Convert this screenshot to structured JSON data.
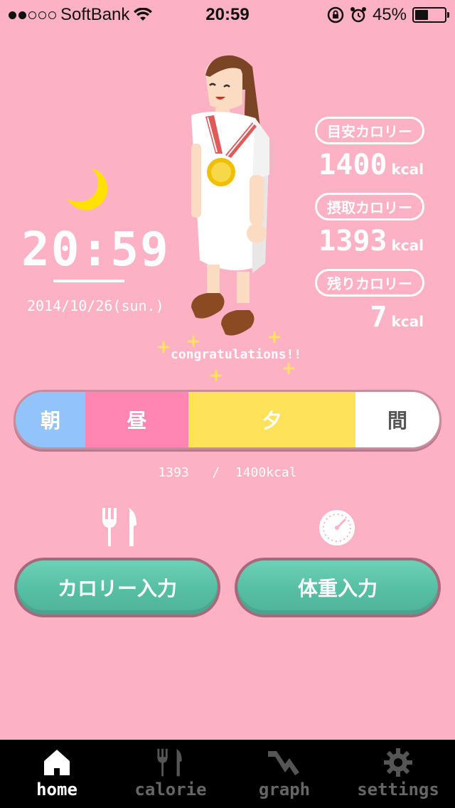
{
  "status_bar": {
    "carrier": "SoftBank",
    "time": "20:59",
    "battery_percent": "45%",
    "battery_level": 0.45,
    "signal_bars_filled": 2,
    "signal_bars_total": 5
  },
  "clock": {
    "time": "20:59",
    "date": "2014/10/26(sun.)"
  },
  "calories": {
    "target_label": "目安カロリー",
    "target_value": "1400",
    "intake_label": "摂取カロリー",
    "intake_value": "1393",
    "remaining_label": "残りカロリー",
    "remaining_value": "7",
    "unit": "kcal"
  },
  "congrats_text": "congratulations!!",
  "meal_bar": {
    "breakfast": "朝",
    "lunch": "昼",
    "dinner": "夕",
    "snack": "間"
  },
  "progress": {
    "current": "1393",
    "separator": "/",
    "total": "1400kcal"
  },
  "buttons": {
    "calorie_input": "カロリー入力",
    "weight_input": "体重入力"
  },
  "tabs": [
    {
      "label": "home",
      "icon": "house-icon",
      "active": true
    },
    {
      "label": "calorie",
      "icon": "fork-knife-icon",
      "active": false
    },
    {
      "label": "graph",
      "icon": "graph-icon",
      "active": false
    },
    {
      "label": "settings",
      "icon": "gear-icon",
      "active": false
    }
  ],
  "colors": {
    "background": "#fdb1c5",
    "breakfast": "#92c4fb",
    "lunch": "#ff86b3",
    "dinner": "#fde25a",
    "snack": "#ffffff",
    "button": "#58c1a6",
    "moon": "#ffe100",
    "medal": "#f0c000"
  }
}
